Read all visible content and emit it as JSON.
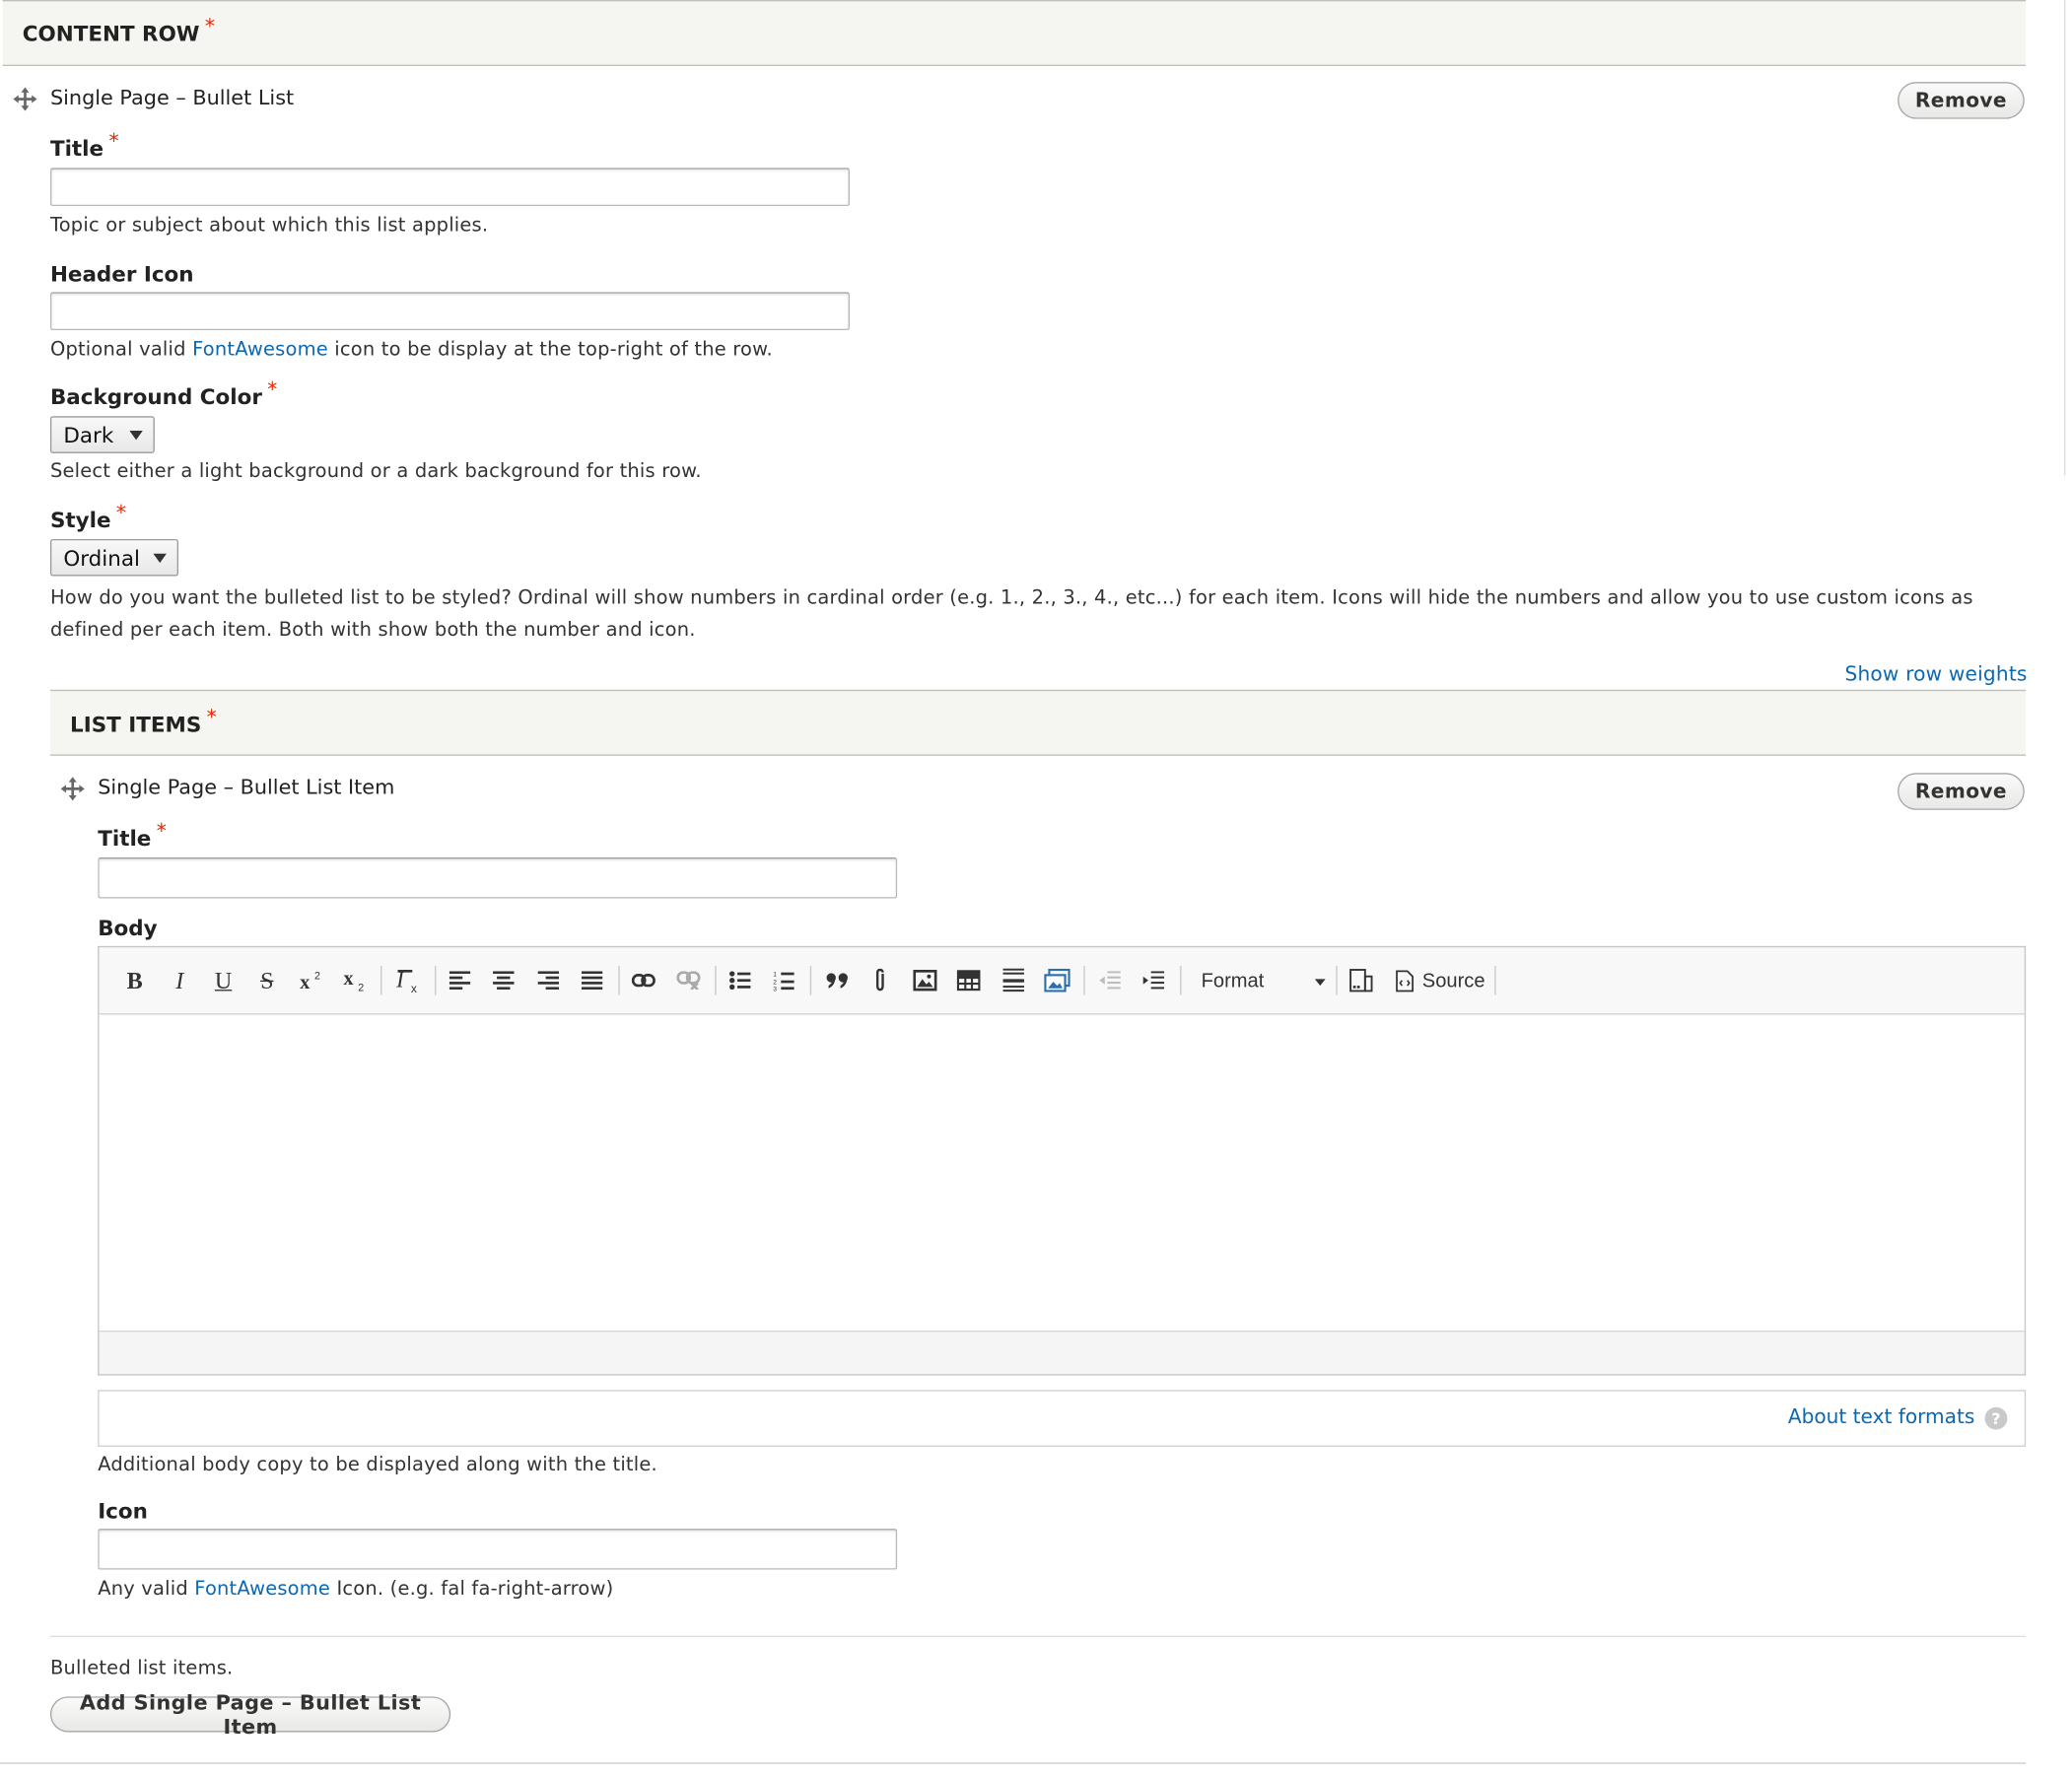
{
  "content_row": {
    "header": "CONTENT ROW",
    "required_mark": "*",
    "paragraph": {
      "title": "Single Page – Bullet List",
      "remove_label": "Remove",
      "title_field": {
        "label": "Title",
        "value": "",
        "description": "Topic or subject about which this list applies."
      },
      "header_icon_field": {
        "label": "Header Icon",
        "value": "",
        "description_before": "Optional valid ",
        "description_link": "FontAwesome",
        "description_after": " icon to be display at the top-right of the row."
      },
      "background_color_field": {
        "label": "Background Color",
        "selected": "Dark",
        "description": "Select either a light background or a dark background for this row."
      },
      "style_field": {
        "label": "Style",
        "selected": "Ordinal",
        "description": "How do you want the bulleted list to be styled? Ordinal will show numbers in cardinal order (e.g. 1., 2., 3., 4., etc...) for each item. Icons will hide the numbers and allow you to use custom icons as defined per each item. Both with show both the number and icon."
      },
      "show_row_weights": "Show row weights"
    }
  },
  "list_items": {
    "header": "LIST ITEMS",
    "item": {
      "title": "Single Page – Bullet List Item",
      "remove_label": "Remove",
      "title_field": {
        "label": "Title",
        "value": ""
      },
      "body_field": {
        "label": "Body",
        "toolbar": {
          "bold": "B",
          "italic": "I",
          "underline": "U",
          "strike": "S",
          "format_label": "Format",
          "source_label": "Source"
        },
        "about_text_formats": "About text formats",
        "help_mark": "?",
        "description": "Additional body copy to be displayed along with the title."
      },
      "icon_field": {
        "label": "Icon",
        "value": "",
        "description_before": "Any valid ",
        "description_link": "FontAwesome",
        "description_after": " Icon. (e.g. fal fa-right-arrow)"
      }
    },
    "description": "Bulleted list items.",
    "add_button": "Add Single Page – Bullet List Item"
  },
  "icons": [
    "drag-handle-icon",
    "bold-icon",
    "italic-icon",
    "underline-icon",
    "strikethrough-icon",
    "superscript-icon",
    "subscript-icon",
    "remove-format-icon",
    "align-left-icon",
    "align-center-icon",
    "align-right-icon",
    "justify-icon",
    "link-icon",
    "unlink-icon",
    "bulleted-list-icon",
    "numbered-list-icon",
    "blockquote-icon",
    "attachment-icon",
    "image-icon",
    "table-icon",
    "horizontal-line-icon",
    "media-embed-icon",
    "outdent-icon",
    "indent-icon",
    "maximize-icon",
    "source-icon",
    "help-icon"
  ],
  "colors": {
    "link": "#0b68b3",
    "required": "#e62600",
    "header_bg": "#f5f5f2"
  }
}
